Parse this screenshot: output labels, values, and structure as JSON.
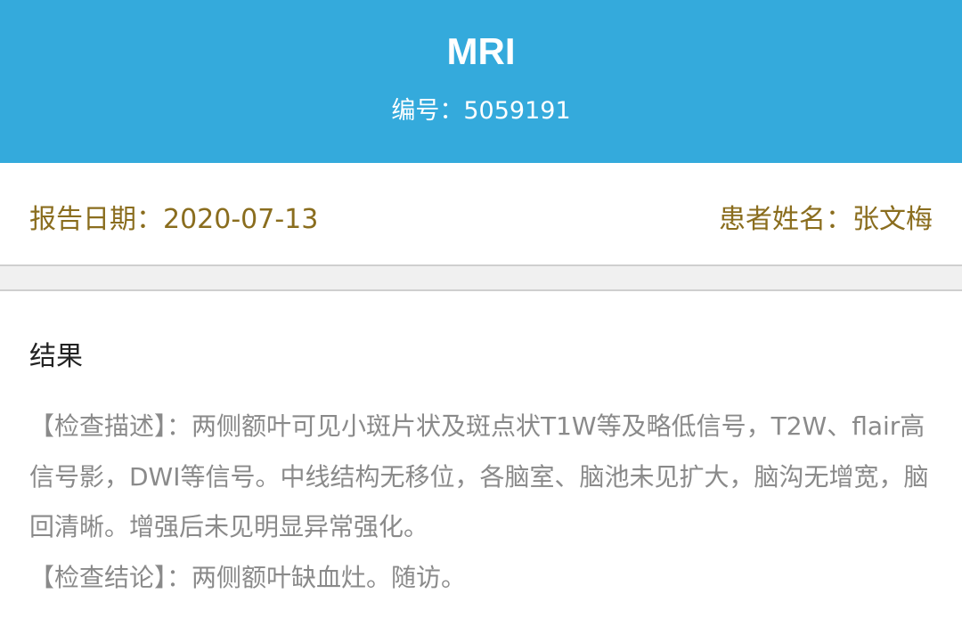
{
  "header": {
    "title": "MRI",
    "number_label": "编号：",
    "number": "5059191",
    "color": "#34aadc"
  },
  "info": {
    "date_label": "报告日期：",
    "date": "2020-07-13",
    "patient_label": "患者姓名：",
    "patient": "张文梅",
    "color": "#8a6d1e"
  },
  "result": {
    "title": "结果",
    "description": "【检查描述】：两侧额叶可见小斑片状及斑点状T1W等及略低信号，T2W、flair高信号影，DWI等信号。中线结构无移位，各脑室、脑池未见扩大，脑沟无增宽，脑回清晰。增强后未见明显异常强化。",
    "conclusion": "【检查结论】：两侧额叶缺血灶。随访。"
  }
}
